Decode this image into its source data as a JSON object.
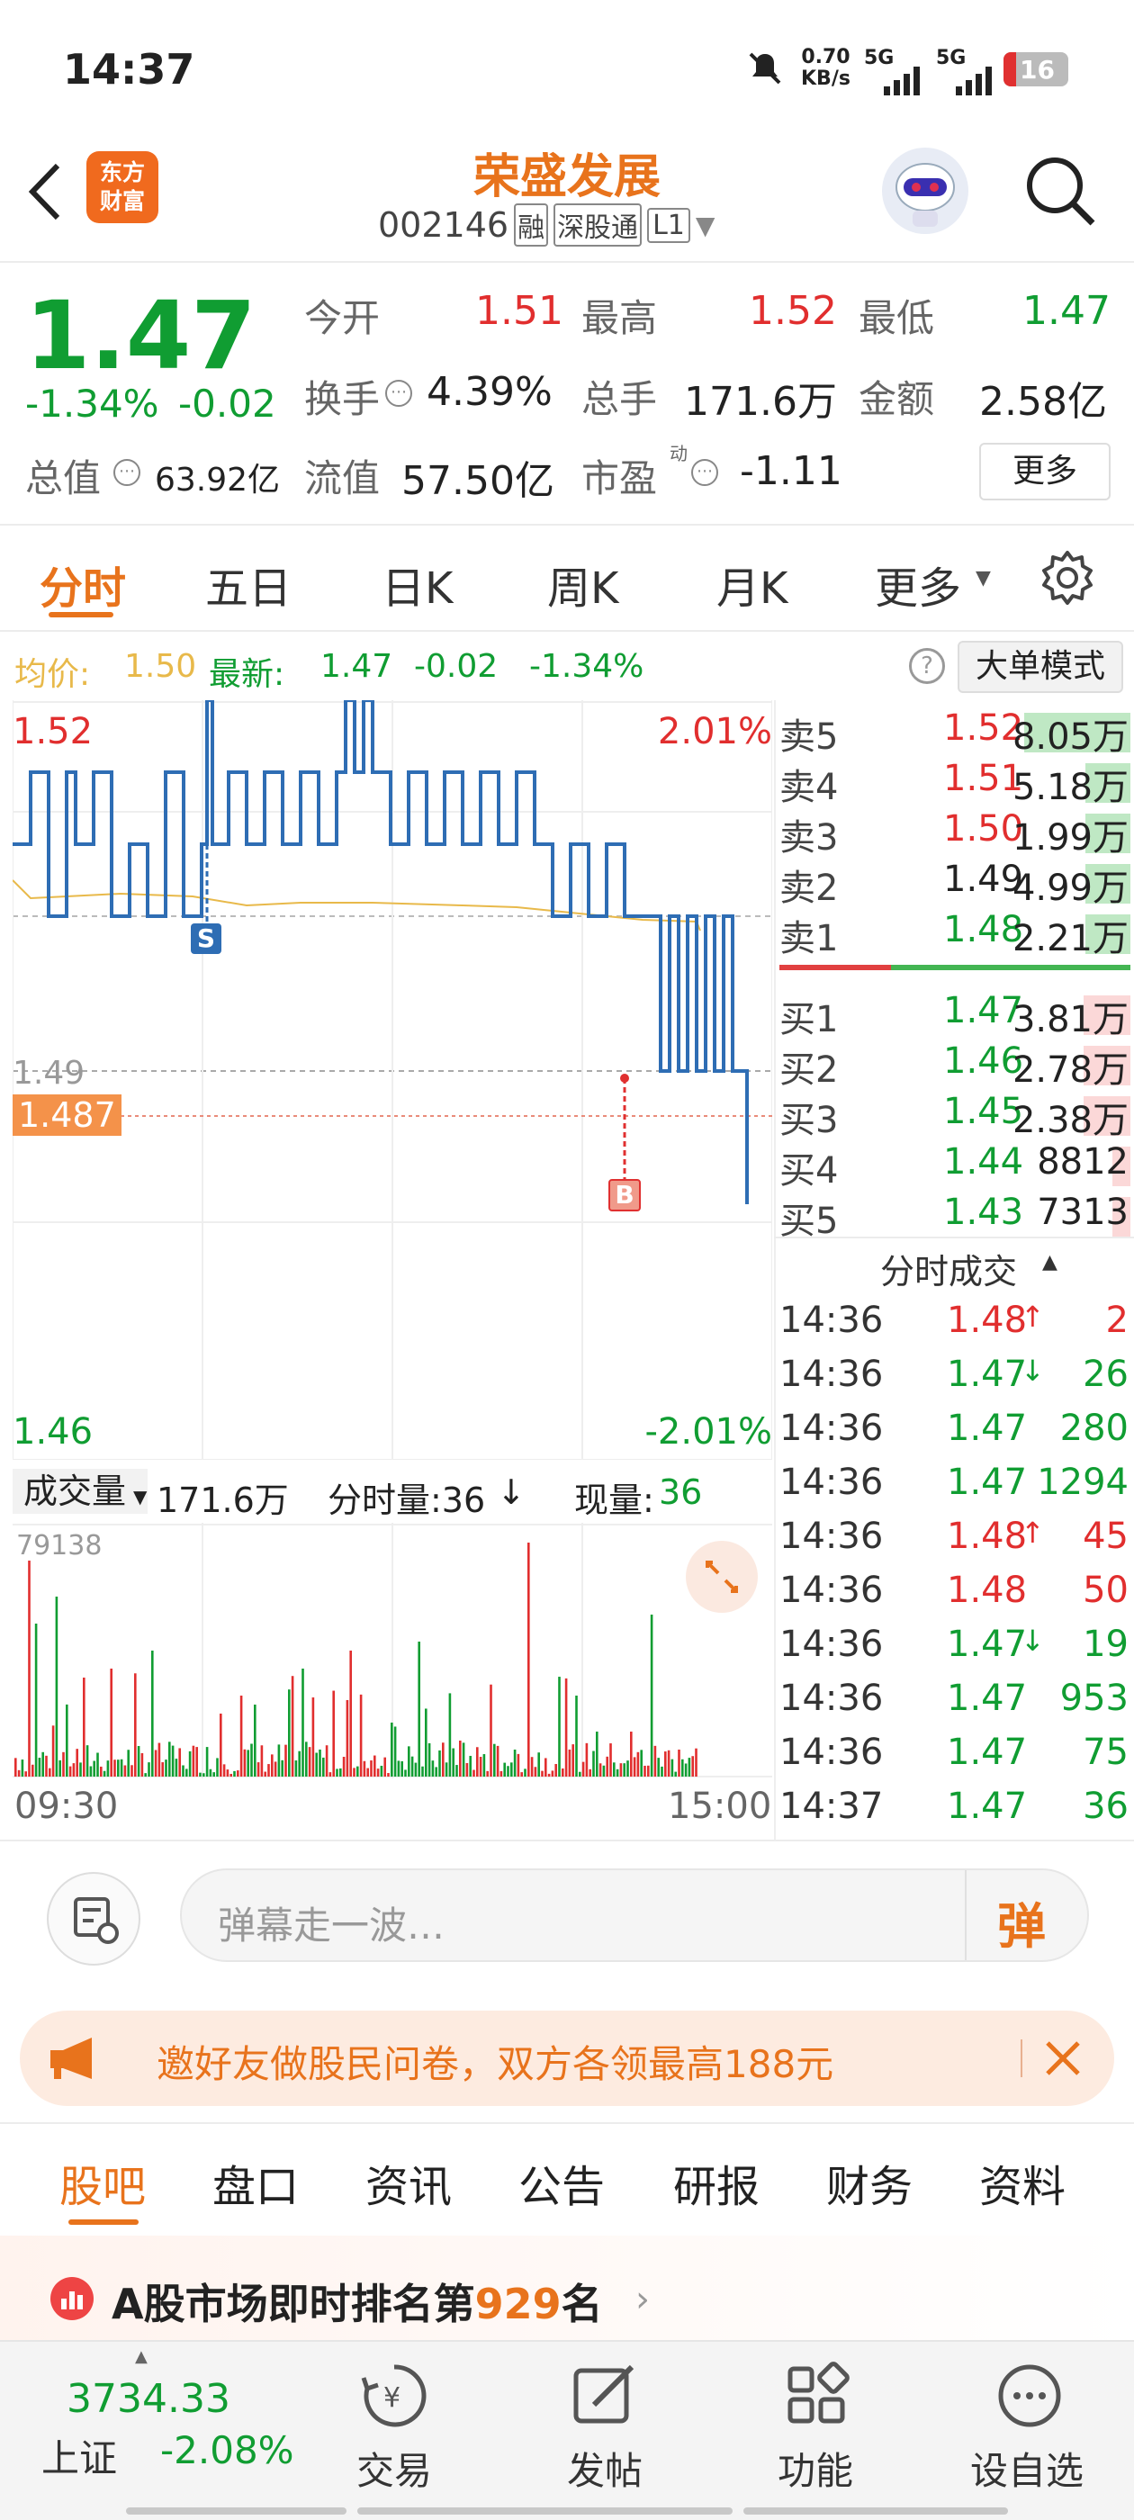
{
  "status": {
    "time": "14:37",
    "speed": "0.70",
    "speed_unit": "KB/s",
    "net1": "5G",
    "net2": "5G",
    "battery": "16"
  },
  "nav": {
    "title": "荣盛发展",
    "code": "002146",
    "tag1": "融",
    "tag2": "深股通",
    "tag3": "L1",
    "logo_line1": "东方",
    "logo_line2": "财富"
  },
  "quote": {
    "price": "1.47",
    "pct": "-1.34%",
    "chg": "-0.02",
    "open_l": "今开",
    "open": "1.51",
    "high_l": "最高",
    "high": "1.52",
    "low_l": "最低",
    "low": "1.47",
    "turn_l": "换手",
    "turn": "4.39%",
    "vol_l": "总手",
    "vol": "171.6万",
    "amt_l": "金额",
    "amt": "2.58亿",
    "mcap_l": "总值",
    "mcap": "63.92亿",
    "fcap_l": "流值",
    "fcap": "57.50亿",
    "pe_l": "市盈",
    "pe_sup": "动",
    "pe": "-1.11",
    "more": "更多"
  },
  "tabs": [
    "分时",
    "五日",
    "日K",
    "周K",
    "月K",
    "更多"
  ],
  "avgbar": {
    "avg_l": "均价:",
    "avg": "1.50",
    "last_l": "最新:",
    "last": "1.47",
    "chg": "-0.02",
    "pct": "-1.34%",
    "mode": "大单模式"
  },
  "chart": {
    "ytop": "1.52",
    "ytop_pct": "2.01%",
    "ymid": "1.49",
    "cursor": "1.487",
    "ybot": "1.46",
    "ybot_pct": "-2.01%",
    "sell_mark": "S",
    "buy_mark": "B",
    "vol_l": "成交量",
    "vol": "171.6万",
    "tick_l": "分时量:36",
    "tick_arrow": "↓",
    "now_l": "现量:",
    "now": "36",
    "vmax": "79138",
    "t_start": "09:30",
    "t_end": "15:00"
  },
  "asks": [
    {
      "l": "卖5",
      "p": "1.52",
      "v": "8.05万",
      "c": "red"
    },
    {
      "l": "卖4",
      "p": "1.51",
      "v": "5.18万",
      "c": "red"
    },
    {
      "l": "卖3",
      "p": "1.50",
      "v": "1.99万",
      "c": "red"
    },
    {
      "l": "卖2",
      "p": "1.49",
      "v": "4.99万",
      "c": "black"
    },
    {
      "l": "卖1",
      "p": "1.48",
      "v": "2.21万",
      "c": "green"
    }
  ],
  "bids": [
    {
      "l": "买1",
      "p": "1.47",
      "v": "3.81万"
    },
    {
      "l": "买2",
      "p": "1.46",
      "v": "2.78万"
    },
    {
      "l": "买3",
      "p": "1.45",
      "v": "2.38万"
    },
    {
      "l": "买4",
      "p": "1.44",
      "v": "8812"
    },
    {
      "l": "买5",
      "p": "1.43",
      "v": "7313"
    }
  ],
  "trades_title": "分时成交",
  "trades": [
    {
      "t": "14:36",
      "p": "1.48",
      "a": "↑",
      "v": "2",
      "c": "red"
    },
    {
      "t": "14:36",
      "p": "1.47",
      "a": "↓",
      "v": "26",
      "c": "green"
    },
    {
      "t": "14:36",
      "p": "1.47",
      "a": "",
      "v": "280",
      "c": "green"
    },
    {
      "t": "14:36",
      "p": "1.47",
      "a": "",
      "v": "1294",
      "c": "green"
    },
    {
      "t": "14:36",
      "p": "1.48",
      "a": "↑",
      "v": "45",
      "c": "red"
    },
    {
      "t": "14:36",
      "p": "1.48",
      "a": "",
      "v": "50",
      "c": "red"
    },
    {
      "t": "14:36",
      "p": "1.47",
      "a": "↓",
      "v": "19",
      "c": "green"
    },
    {
      "t": "14:36",
      "p": "1.47",
      "a": "",
      "v": "953",
      "c": "green"
    },
    {
      "t": "14:36",
      "p": "1.47",
      "a": "",
      "v": "75",
      "c": "green"
    },
    {
      "t": "14:37",
      "p": "1.47",
      "a": "",
      "v": "36",
      "c": "green"
    }
  ],
  "danmu": {
    "placeholder": "弹幕走一波…",
    "btn": "弹"
  },
  "banner": {
    "text": "邀好友做股民问卷，双方各领最高188元"
  },
  "subtabs": [
    "股吧",
    "盘口",
    "资讯",
    "公告",
    "研报",
    "财务",
    "资料"
  ],
  "rank": {
    "pre": "A股市场即时排名第",
    "num": "929",
    "post": "名"
  },
  "bottom": {
    "index_val": "3734.33",
    "index_name": "上证",
    "index_pct": "-2.08%",
    "trade": "交易",
    "post": "发帖",
    "func": "功能",
    "watch": "设自选"
  },
  "colors": {
    "up": "#e12e2e",
    "down": "#109d32",
    "accent": "#e8731c",
    "line": "#2e6db4",
    "avg": "#e8b94a"
  }
}
